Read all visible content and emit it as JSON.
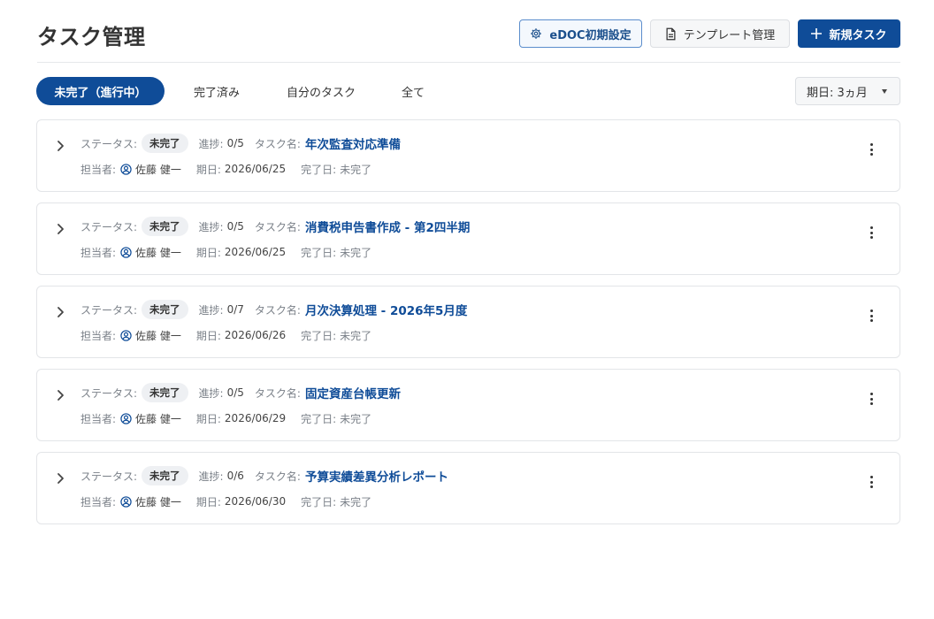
{
  "header": {
    "title": "タスク管理",
    "edoc_button": "eDOC初期設定",
    "template_button": "テンプレート管理",
    "new_task_button": "新規タスク"
  },
  "tabs": [
    {
      "label": "未完了（進行中）",
      "active": true
    },
    {
      "label": "完了済み",
      "active": false
    },
    {
      "label": "自分のタスク",
      "active": false
    },
    {
      "label": "全て",
      "active": false
    }
  ],
  "due_filter": {
    "label": "期日: 3ヵ月"
  },
  "labels": {
    "status": "ステータス:",
    "progress": "進捗:",
    "task_name": "タスク名:",
    "assignee": "担当者:",
    "due": "期日:",
    "completed": "完了日:"
  },
  "tasks": [
    {
      "status": "未完了",
      "progress": "0/5",
      "name": "年次監査対応準備",
      "assignee": "佐藤 健一",
      "due": "2026/06/25",
      "completed": "未完了"
    },
    {
      "status": "未完了",
      "progress": "0/5",
      "name": "消費税申告書作成 - 第2四半期",
      "assignee": "佐藤 健一",
      "due": "2026/06/25",
      "completed": "未完了"
    },
    {
      "status": "未完了",
      "progress": "0/7",
      "name": "月次決算処理 - 2026年5月度",
      "assignee": "佐藤 健一",
      "due": "2026/06/26",
      "completed": "未完了"
    },
    {
      "status": "未完了",
      "progress": "0/5",
      "name": "固定資産台帳更新",
      "assignee": "佐藤 健一",
      "due": "2026/06/29",
      "completed": "未完了"
    },
    {
      "status": "未完了",
      "progress": "0/6",
      "name": "予算実績差異分析レポート",
      "assignee": "佐藤 健一",
      "due": "2026/06/30",
      "completed": "未完了"
    }
  ],
  "colors": {
    "accent": "#0f4c98",
    "link": "#0f4c98",
    "badge_bg": "#eef0f3"
  }
}
